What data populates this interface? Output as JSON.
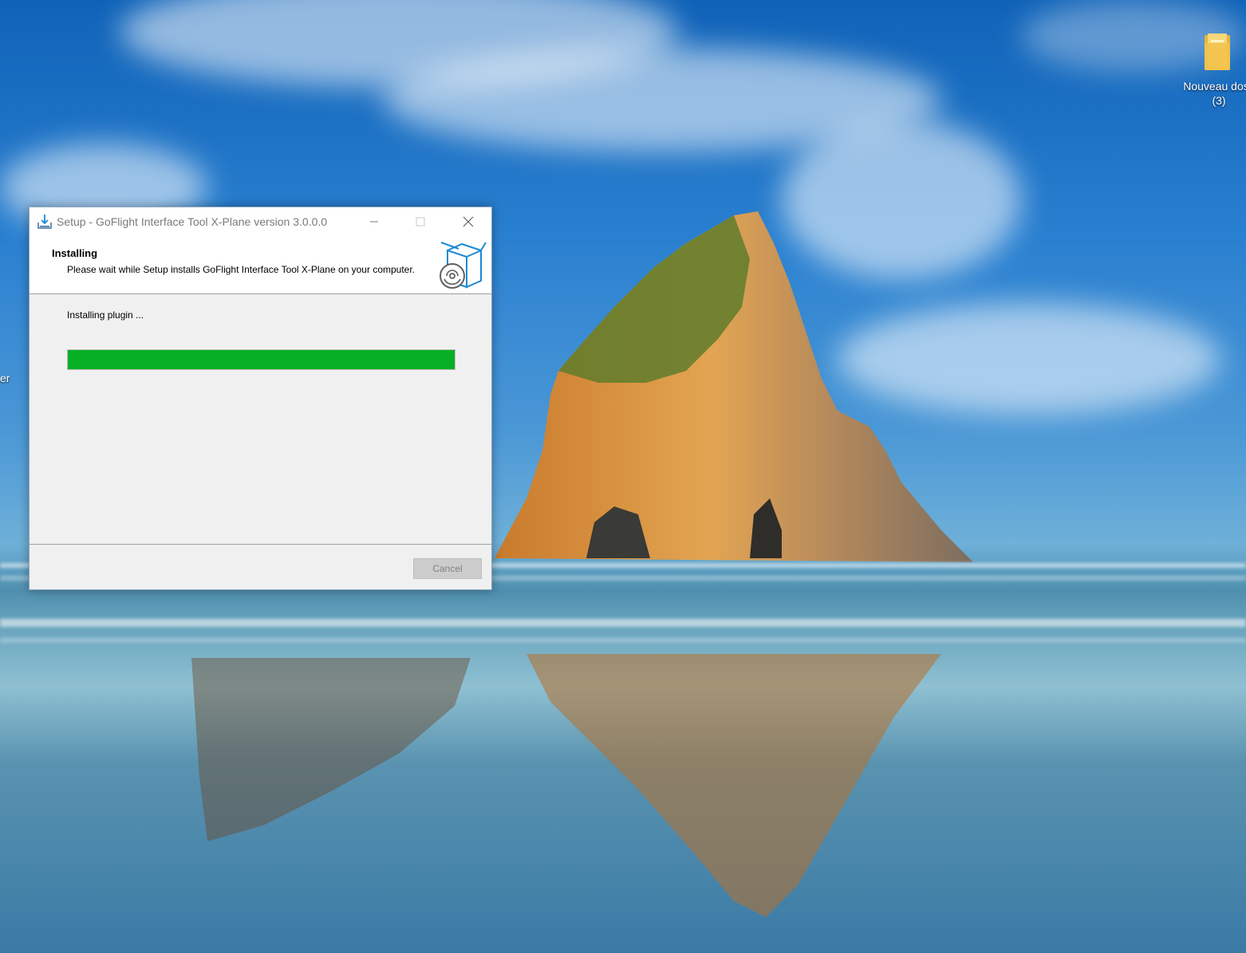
{
  "desktop": {
    "icons": [
      {
        "label_line1": "Nouveau doss",
        "label_line2": "(3)",
        "icon": "folder-icon"
      }
    ],
    "edge_label": "er"
  },
  "window": {
    "title": "Setup - GoFlight Interface Tool X-Plane version 3.0.0.0",
    "controls": {
      "minimize": "minimize-icon",
      "maximize": "maximize-icon",
      "close": "close-icon"
    },
    "header": {
      "title": "Installing",
      "description": "Please wait while Setup installs GoFlight Interface Tool X-Plane on your computer."
    },
    "status": "Installing plugin ...",
    "progress_percent": 100,
    "cancel_label": "Cancel",
    "cancel_enabled": false
  },
  "colors": {
    "progress_fill": "#06b025",
    "title_text": "#7a7a7a",
    "window_bg": "#f0f0f0",
    "accent_blue": "#1a8ad4"
  }
}
